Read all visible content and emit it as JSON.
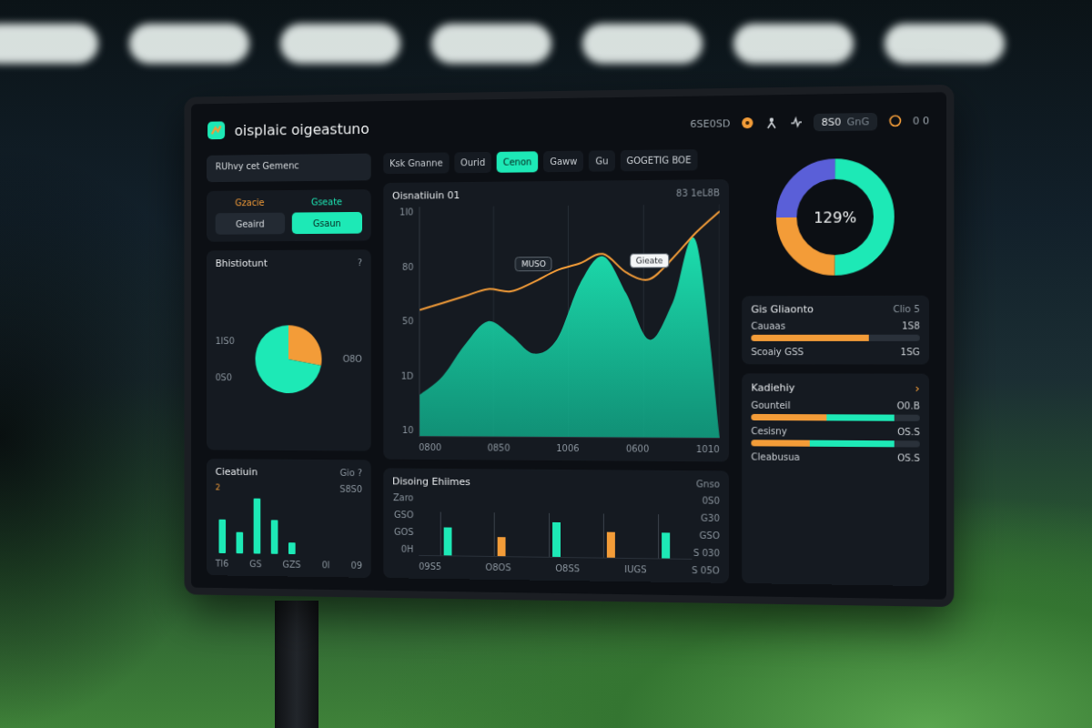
{
  "header": {
    "title": "oisplaic oigeastuno",
    "meta": "6SE0SD",
    "badge": "8S0",
    "badge_note": "GnG",
    "end": "0 0"
  },
  "field": {
    "label": "RUhvy cet Gemenc"
  },
  "toggle": {
    "labels": [
      {
        "label": "Gzacie",
        "color": "#f39c38"
      },
      {
        "label": "Gseate",
        "color": "#1de9b6"
      }
    ],
    "buttons": [
      {
        "label": "Geaird",
        "selected": false
      },
      {
        "label": "Gsaun",
        "selected": true
      }
    ]
  },
  "pie": {
    "title": "Bhistiotunt",
    "help": "?",
    "labels": [
      "1IS0",
      "0S0",
      "O8O"
    ],
    "slices": [
      {
        "value": 28,
        "color": "#f39c38"
      },
      {
        "value": 72,
        "color": "#1de9b6"
      }
    ]
  },
  "mini_bars": {
    "title": "Cieatiuin",
    "action": "Gio ?",
    "marker": "2",
    "reading": "S8S0",
    "values": [
      36,
      22,
      58,
      36,
      12
    ],
    "labels": [
      "Tl6",
      "GS",
      "GZS",
      "0l",
      "09"
    ]
  },
  "tabs": [
    {
      "label": "Ksk Gnanne",
      "selected": false
    },
    {
      "label": "Ourid",
      "selected": false
    },
    {
      "label": "Cenon",
      "selected": true
    },
    {
      "label": "Gaww",
      "selected": false
    },
    {
      "label": "Gu",
      "selected": false
    },
    {
      "label": "GOGETIG BOE",
      "selected": false
    }
  ],
  "chart": {
    "title": "Oisnatiiuin 01",
    "reading": "83 1eL8B",
    "y_ticks": [
      "1I0",
      "80",
      "50",
      "1D",
      "10"
    ],
    "x_ticks": [
      "0800",
      "0850",
      "1006",
      "0600",
      "1010"
    ],
    "area": [
      18,
      26,
      40,
      50,
      44,
      36,
      42,
      66,
      78,
      62,
      42,
      58,
      84,
      0
    ],
    "line": [
      55,
      58,
      61,
      64,
      63,
      67,
      72,
      75,
      79,
      71,
      68,
      77,
      88,
      97
    ],
    "tooltips": [
      {
        "label": "MUSO",
        "point": 5
      },
      {
        "label": "Gieate",
        "point": 10
      }
    ]
  },
  "events": {
    "title": "Disoing Ehiimes",
    "action": "Gnso",
    "left_ticks": [
      "Zaro",
      "GSO",
      "GOS",
      "0H"
    ],
    "right_ticks": [
      "0S0",
      "G30",
      "GSO",
      "S 030"
    ],
    "x_ticks": [
      "09S5",
      "O8OS",
      "O8SS",
      "IUGS",
      "S 05O"
    ],
    "bars": [
      {
        "value": 45,
        "color": "#1de9b6"
      },
      {
        "value": 30,
        "color": "#f39c38"
      },
      {
        "value": 55,
        "color": "#1de9b6"
      },
      {
        "value": 40,
        "color": "#f39c38"
      },
      {
        "value": 40,
        "color": "#1de9b6"
      }
    ]
  },
  "donut": {
    "label": "129%",
    "segments": [
      {
        "value": 25,
        "color": "#5a5fd8"
      },
      {
        "value": 50,
        "color": "#1de9b6"
      },
      {
        "value": 25,
        "color": "#f39c38"
      }
    ]
  },
  "summary": {
    "title": "Gis Gliaonto",
    "action": "Clio",
    "count": "5",
    "rows": [
      {
        "label": "Cauaas",
        "value": "1S8",
        "kind": "bar",
        "levels": [
          0.7
        ]
      },
      {
        "label": "Scoaiy GSS",
        "value": "1SG",
        "kind": "text"
      }
    ]
  },
  "activity": {
    "title": "Kadiehiy",
    "arrow": "›",
    "rows": [
      {
        "label": "Gounteil",
        "value": "O0.B",
        "kind": "bar",
        "levels": [
          0.45,
          0.4
        ]
      },
      {
        "label": "Cesisny",
        "value": "OS.S",
        "kind": "bar",
        "levels": [
          0.35,
          0.5
        ]
      },
      {
        "label": "Cleabusua",
        "value": "OS.S",
        "kind": "text"
      }
    ]
  }
}
